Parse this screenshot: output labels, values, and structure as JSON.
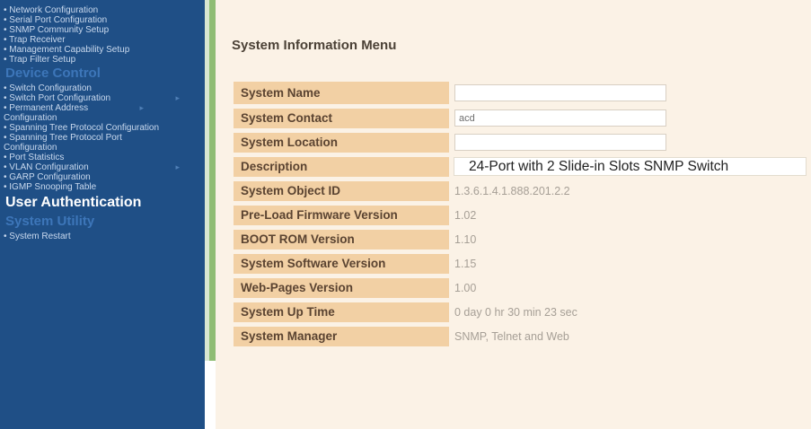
{
  "sidebar": {
    "group1": [
      {
        "label": "• Network Configuration",
        "arrow": false
      },
      {
        "label": "• Serial Port Configuration",
        "arrow": false
      },
      {
        "label": "• SNMP Community Setup",
        "arrow": false
      },
      {
        "label": "• Trap Receiver",
        "arrow": false
      },
      {
        "label": "• Management Capability Setup",
        "arrow": false
      },
      {
        "label": "• Trap Filter Setup",
        "arrow": false
      }
    ],
    "section_device": "Device Control",
    "group2": [
      {
        "label": "• Switch Configuration",
        "arrow": false,
        "multi": false
      },
      {
        "label": "• Switch Port Configuration",
        "arrow": true,
        "multi": false
      },
      {
        "label": "• Permanent Address Configuration",
        "arrow": true,
        "multi": true
      },
      {
        "label": "• Spanning Tree Protocol Configuration",
        "arrow": false,
        "multi": true
      },
      {
        "label": "• Spanning Tree Protocol Port Configuration",
        "arrow": false,
        "multi": true
      },
      {
        "label": "• Port Statistics",
        "arrow": false,
        "multi": false
      },
      {
        "label": "• VLAN Configuration",
        "arrow": true,
        "multi": false
      },
      {
        "label": "• GARP Configuration",
        "arrow": false,
        "multi": false
      },
      {
        "label": "• IGMP Snooping Table",
        "arrow": false,
        "multi": false
      }
    ],
    "section_auth": "User Authentication",
    "section_utility": "System Utility",
    "group3": [
      {
        "label": "• System Restart",
        "arrow": false
      }
    ],
    "arrow_glyph": "▸"
  },
  "main": {
    "title": "System Information Menu",
    "fields": {
      "system_name": {
        "label": "System Name",
        "value": ""
      },
      "system_contact": {
        "label": "System Contact",
        "value": "acd"
      },
      "system_location": {
        "label": "System Location",
        "value": ""
      },
      "description": {
        "label": "Description",
        "value": "24-Port with 2 Slide-in Slots SNMP Switch"
      },
      "object_id": {
        "label": "System Object ID",
        "value": "1.3.6.1.4.1.888.201.2.2"
      },
      "preload_fw": {
        "label": "Pre-Load Firmware Version",
        "value": "1.02"
      },
      "boot_rom": {
        "label": "BOOT ROM Version",
        "value": "1.10"
      },
      "software_version": {
        "label": "System Software Version",
        "value": "1.15"
      },
      "web_pages_version": {
        "label": "Web-Pages Version",
        "value": "1.00"
      },
      "up_time": {
        "label": "System Up Time",
        "value": "0 day 0 hr 30 min 23 sec"
      },
      "manager": {
        "label": "System Manager",
        "value": "SNMP, Telnet and Web"
      }
    }
  },
  "colors": {
    "sidebar_bg": "#1f4f86",
    "sidebar_text": "#c9d9ee",
    "section_text": "#3d76b9",
    "divider_green": "#8fbd74",
    "content_bg": "#fbf2e6",
    "label_bg": "#f2d0a4",
    "label_text": "#5a4331"
  }
}
